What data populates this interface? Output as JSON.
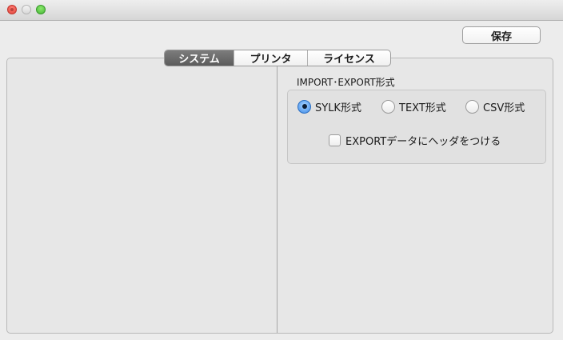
{
  "window": {
    "traffic_lights": [
      "close",
      "minimize",
      "zoom"
    ]
  },
  "toolbar": {
    "save_label": "保存"
  },
  "tabs": [
    {
      "label": "システム",
      "selected": true
    },
    {
      "label": "プリンタ",
      "selected": false
    },
    {
      "label": "ライセンス",
      "selected": false
    }
  ],
  "import_export": {
    "group_label": "IMPORT･EXPORT形式",
    "options": [
      {
        "label": "SYLK形式",
        "selected": true
      },
      {
        "label": "TEXT形式",
        "selected": false
      },
      {
        "label": "CSV形式",
        "selected": false
      }
    ],
    "header_checkbox": {
      "label": "EXPORTデータにヘッダをつける",
      "checked": false
    }
  },
  "colors": {
    "accent": "#3d8ae8",
    "selected_tab": "#6a6a6a",
    "close": "#e0443a",
    "zoom": "#45b436"
  }
}
